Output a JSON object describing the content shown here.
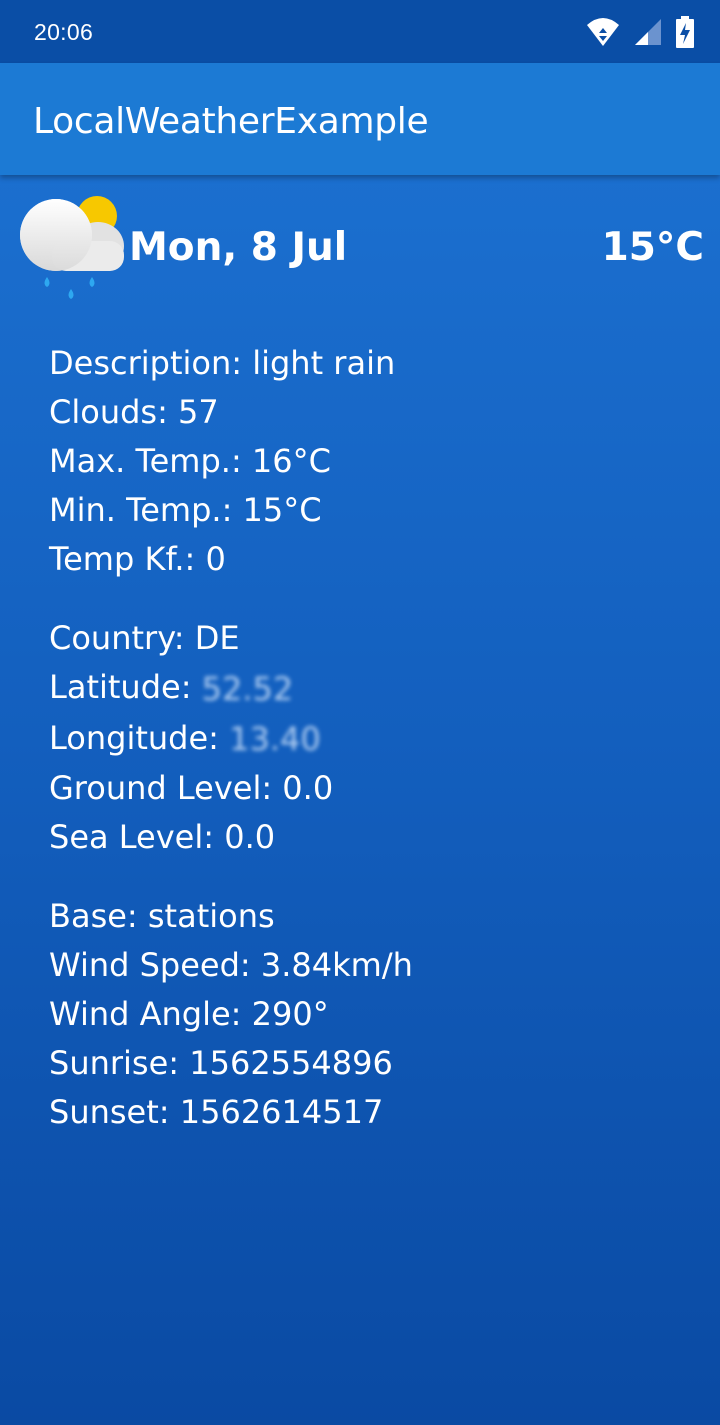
{
  "status_bar": {
    "time": "20:06",
    "icons": [
      "wifi-icon",
      "signal-icon",
      "battery-charging-icon"
    ]
  },
  "app_bar": {
    "title": "LocalWeatherExample"
  },
  "header": {
    "icon": "light-rain-cloud-icon",
    "date": "Mon, 8 Jul",
    "temperature": "15°C"
  },
  "details": {
    "description": {
      "label": "Description: ",
      "value": "light rain"
    },
    "clouds": {
      "label": "Clouds: ",
      "value": "57"
    },
    "max_temp": {
      "label": "Max. Temp.: ",
      "value": "16°C"
    },
    "min_temp": {
      "label": "Min. Temp.: ",
      "value": "15°C"
    },
    "temp_kf": {
      "label": "Temp Kf.: ",
      "value": "0"
    },
    "country": {
      "label": "Country: ",
      "value": "DE"
    },
    "latitude": {
      "label": "Latitude: ",
      "value": "52.52"
    },
    "longitude": {
      "label": "Longitude: ",
      "value": "13.40"
    },
    "ground_level": {
      "label": "Ground Level: ",
      "value": "0.0"
    },
    "sea_level": {
      "label": "Sea Level: ",
      "value": "0.0"
    },
    "base": {
      "label": "Base: ",
      "value": "stations"
    },
    "wind_speed": {
      "label": "Wind Speed: ",
      "value": "3.84km/h"
    },
    "wind_angle": {
      "label": "Wind Angle: ",
      "value": "290°"
    },
    "sunrise": {
      "label": "Sunrise: ",
      "value": "1562554896"
    },
    "sunset": {
      "label": "Sunset: ",
      "value": "1562614517"
    }
  },
  "colors": {
    "status_bar": "#0a4ea6",
    "app_bar": "#1c7ad4",
    "background_top": "#1b6fcf",
    "background_bottom": "#0a4aa3",
    "sun": "#f7c800",
    "rain": "#2ea8f0"
  }
}
